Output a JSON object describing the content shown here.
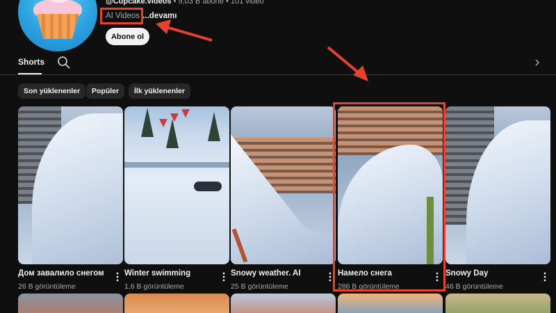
{
  "channel": {
    "handle": "@Cupcake.videos",
    "subscribers": "9,03 B abone",
    "video_count": "101 video",
    "separator": "•",
    "description": "AI Videos",
    "more_link": "...devamı",
    "subscribe_label": "Abone ol"
  },
  "tabs": {
    "active_label": "Shorts"
  },
  "chips": [
    {
      "label": "Son yüklenenler"
    },
    {
      "label": "Popüler"
    },
    {
      "label": "İlk yüklenenler"
    }
  ],
  "shorts": [
    {
      "title": "Дом завалило снегом",
      "views": "26 B görüntüleme"
    },
    {
      "title": "Winter swimming",
      "views": "1,6 B görüntüleme"
    },
    {
      "title": "Snowy weather. AI",
      "views": "25 B görüntüleme"
    },
    {
      "title": "Намело снега",
      "views": "286 B görüntüleme"
    },
    {
      "title": "Snowy Day",
      "views": "46 B görüntüleme"
    }
  ],
  "colors": {
    "background": "#0f0f0f",
    "annotation": "#e8412c",
    "chip_bg": "#272727",
    "text_primary": "#f1f1f1",
    "text_secondary": "#aaaaaa"
  },
  "icons": [
    "search-icon",
    "chevron-right-icon",
    "more-vert-icon",
    "annotation-arrow"
  ]
}
